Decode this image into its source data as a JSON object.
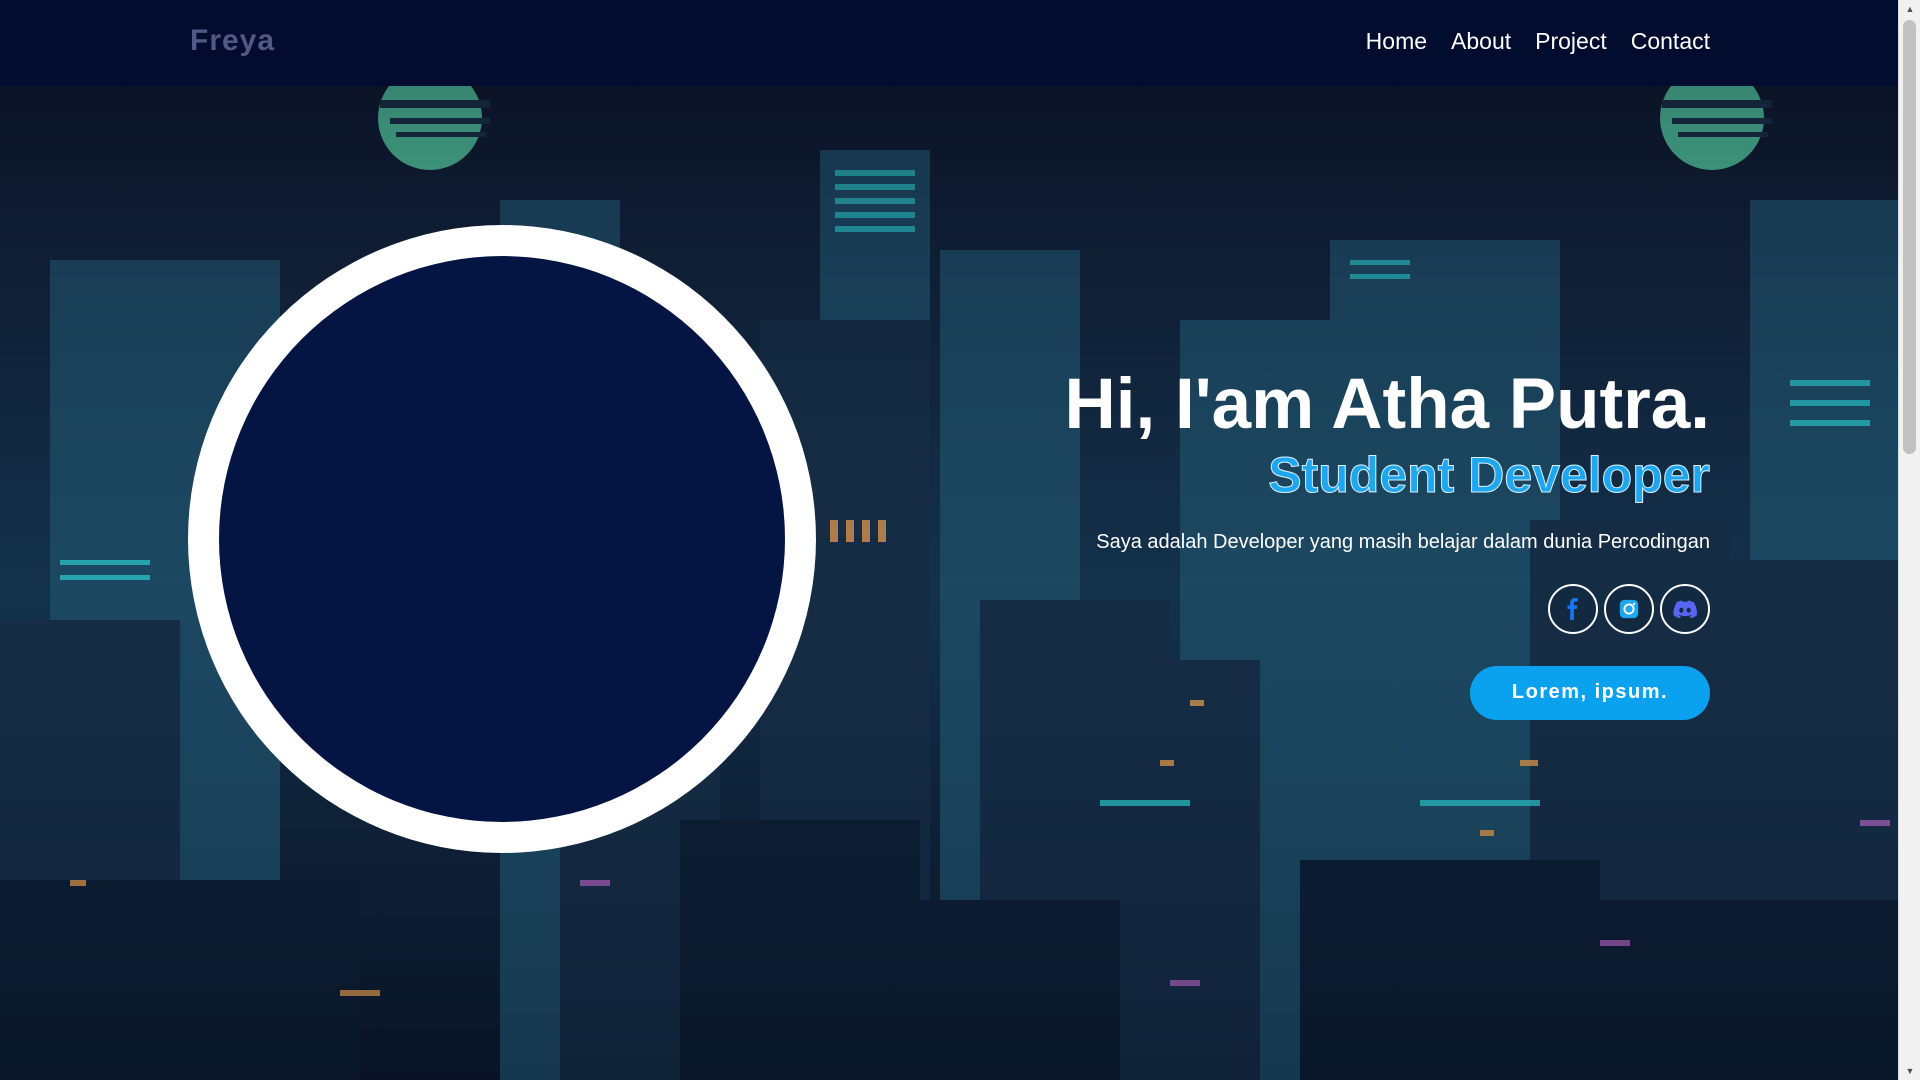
{
  "brand": {
    "name": "Freya"
  },
  "nav": {
    "items": [
      {
        "label": "Home"
      },
      {
        "label": "About"
      },
      {
        "label": "Project"
      },
      {
        "label": "Contact"
      }
    ]
  },
  "hero": {
    "title": "Hi, I'am Atha Putra.",
    "subtitle": "Student Developer",
    "description": "Saya adalah Developer yang masih belajar dalam dunia Percodingan",
    "cta_label": "Lorem, ipsum."
  },
  "socials": [
    {
      "icon": "facebook-icon"
    },
    {
      "icon": "instagram-icon"
    },
    {
      "icon": "discord-icon"
    }
  ],
  "colors": {
    "navbar_bg": "#020c2e",
    "brand_text": "#4f5b86",
    "accent": "#0aa2ef",
    "subtitle": "#1ea6ef",
    "profile_fill": "#041544",
    "profile_ring": "#ffffff"
  }
}
